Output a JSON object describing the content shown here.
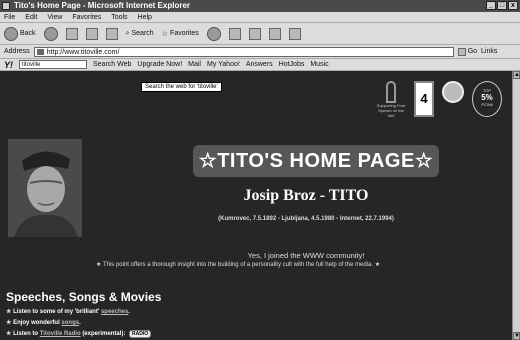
{
  "window": {
    "title": "Tito's Home Page - Microsoft Internet Explorer",
    "controls": [
      "_",
      "□",
      "x"
    ]
  },
  "menu": {
    "items": [
      "File",
      "Edit",
      "View",
      "Favorites",
      "Tools",
      "Help"
    ]
  },
  "nav": {
    "back": "Back",
    "search": "Search",
    "favorites": "Favorites"
  },
  "address": {
    "label": "Address",
    "url": "http://www.titoville.com/",
    "go": "Go",
    "links": "Links"
  },
  "yahoo_toolbar": {
    "logo": "Y!",
    "query": "titoville",
    "search_web": "Search Web",
    "upgrade": "Upgrade Now!",
    "mail": "Mail",
    "my_yahoo": "My Yahoo!",
    "answers": "Answers",
    "hotjobs": "HotJobs",
    "music": "Music"
  },
  "tooltip": "Search the web for 'titoville'",
  "badges": {
    "ribbon_text": "Supporting Free Speech on the Net",
    "rank": "4",
    "award_top": "TOP",
    "award_mid": "5%",
    "award_bottom": "PCWit"
  },
  "header": {
    "logo": "☆TITO'S HOME PAGE☆",
    "name": "Josip Broz - TITO",
    "dates": "(Kumrovec, 7.5.1892 - Ljubljana, 4.5.1980 - Internet, 22.7.1994)"
  },
  "intro": {
    "joined": "Yes, I joined the WWW community!",
    "insight": "This point offers a thorough insight into the building of a personality cult with the full help of the media."
  },
  "section": {
    "title": "Speeches, Songs & Movies",
    "items": [
      {
        "prefix": "Listen to some of my 'brilliant'",
        "link": "speeches",
        "suffix": "."
      },
      {
        "prefix": "Enjoy wonderful",
        "link": "songs",
        "suffix": "."
      },
      {
        "prefix": "Listen to",
        "link": "Titoville Radio",
        "suffix": "(experimental):",
        "button": "RADIO"
      }
    ]
  }
}
